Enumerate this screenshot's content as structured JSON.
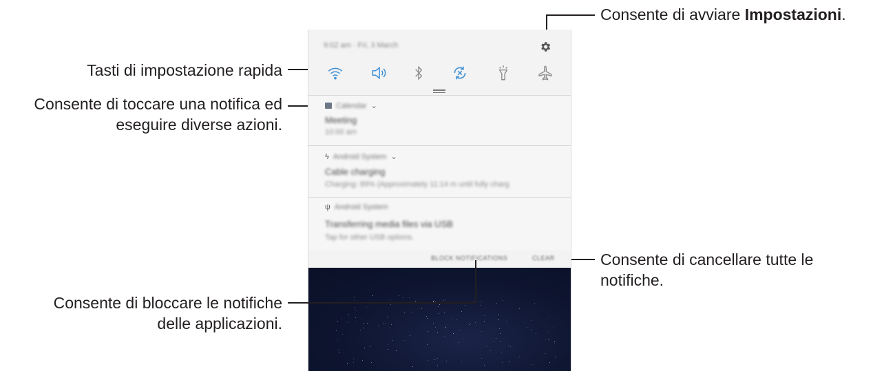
{
  "callouts": {
    "settings": {
      "prefix": "Consente di avviare ",
      "bold": "Impostazioni",
      "suffix": "."
    },
    "quick_settings": "Tasti di impostazione rapida",
    "notification_line1": "Consente di toccare una notifica ed",
    "notification_line2": "eseguire diverse azioni.",
    "clear_line1": "Consente di cancellare tutte le",
    "clear_line2": "notifiche.",
    "block_line1": "Consente di bloccare le notifiche",
    "block_line2": "delle applicazioni."
  },
  "panel": {
    "status_date": "9:02 am · Fri, 3 March",
    "settings_icon": "gear-icon",
    "quick_settings": [
      {
        "name": "wifi-icon",
        "active": true
      },
      {
        "name": "sound-icon",
        "active": true
      },
      {
        "name": "bluetooth-icon",
        "active": false
      },
      {
        "name": "auto-rotate-icon",
        "active": true
      },
      {
        "name": "flashlight-icon",
        "active": false
      },
      {
        "name": "airplane-mode-icon",
        "active": false
      }
    ],
    "notifications": [
      {
        "app": "Calendar",
        "title": "Meeting",
        "subtitle": "10:00 am"
      },
      {
        "app": "Android System",
        "title": "Cable charging",
        "subtitle": "Charging: 89% (Approximately 11:14 m until fully charg"
      },
      {
        "app": "Android System",
        "title": "Transferring media files via USB",
        "subtitle": "Tap for other USB options."
      }
    ],
    "block_button": "BLOCK NOTIFICATIONS",
    "clear_button": "CLEAR"
  },
  "colors": {
    "accent": "#3e91d6",
    "inactive_icon": "#8c8c8c",
    "text": "#231f20"
  }
}
